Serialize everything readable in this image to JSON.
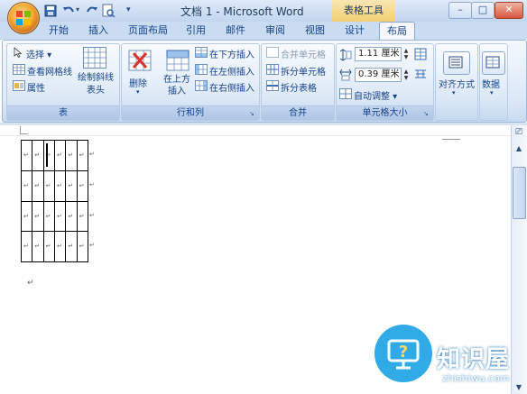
{
  "window": {
    "title": "文档 1 - Microsoft Word",
    "contextual_tab": "表格工具",
    "controls": [
      "–",
      "□",
      "✕"
    ]
  },
  "tabs": [
    {
      "label": "开始",
      "active": false
    },
    {
      "label": "插入",
      "active": false
    },
    {
      "label": "页面布局",
      "active": false
    },
    {
      "label": "引用",
      "active": false
    },
    {
      "label": "邮件",
      "active": false
    },
    {
      "label": "审阅",
      "active": false
    },
    {
      "label": "视图",
      "active": false
    },
    {
      "label": "设计",
      "active": false
    },
    {
      "label": "布局",
      "active": true
    }
  ],
  "ribbon": {
    "table_group": {
      "label": "表",
      "select": "选择",
      "view_gridlines": "查看网格线",
      "properties": "属性",
      "draw_diagonal_line": "绘制斜线表头"
    },
    "rows_cols_group": {
      "label": "行和列",
      "delete": "删除",
      "insert_above": "在上方插入",
      "insert_below": "在下方插入",
      "insert_left": "在左侧插入",
      "insert_right": "在右侧插入"
    },
    "merge_group": {
      "label": "合并",
      "merge_cells": "合并单元格",
      "split_cells": "拆分单元格",
      "split_table": "拆分表格"
    },
    "cell_size_group": {
      "label": "单元格大小",
      "height_value": "1.11 厘米",
      "width_value": "0.39 厘米",
      "autofit": "自动调整"
    },
    "alignment": "对齐方式",
    "data": "数据"
  },
  "table": {
    "rows": 4,
    "cols": 6
  },
  "watermark": {
    "brand": "知识屋",
    "url": "zhishiwu.com"
  },
  "colors": {
    "accent": "#1ba1e6",
    "ribbon": "#dbe8f7",
    "title_bar": "#c2d6f0"
  }
}
